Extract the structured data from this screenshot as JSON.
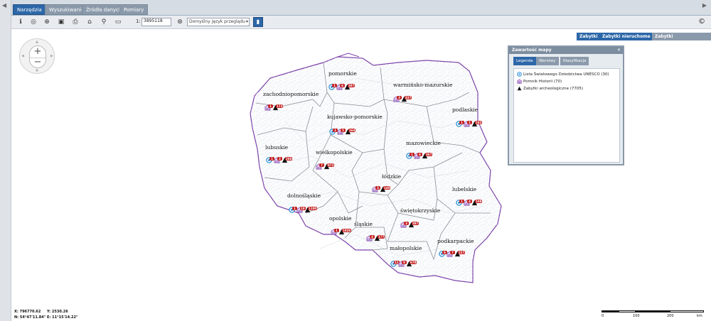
{
  "tabs": [
    {
      "label": "Narzędzia",
      "active": true
    },
    {
      "label": "Wyszukiwanie",
      "active": false
    },
    {
      "label": "Źródła danych",
      "active": false
    },
    {
      "label": "Pomiary",
      "active": false
    }
  ],
  "toolbar": {
    "scale_prefix": "1:",
    "scale_value": "3895118",
    "language_select": "Domyślny język przeglądu",
    "icons": [
      "info-icon",
      "identify-icon",
      "zoom-extent-icon",
      "save-icon",
      "print-icon",
      "home-icon",
      "link-icon",
      "screenshot-icon",
      "search-zoom-icon"
    ]
  },
  "layer_buttons": [
    {
      "label": "Zabytki",
      "color": "#2d67a8"
    },
    {
      "label": "Zabytki nieruchome",
      "color": "#2d67a8"
    },
    {
      "label": "Zabytki archeologiczne",
      "color": "#8b9aab"
    }
  ],
  "panel": {
    "title": "Zawartość mapy",
    "tabs": [
      {
        "label": "Legenda",
        "active": true
      },
      {
        "label": "Warstwy",
        "active": false
      },
      {
        "label": "Klasyfikacja",
        "active": false
      }
    ],
    "legend": [
      {
        "label": "Lista Światowego Dziedzictwa UNESCO (30)",
        "icon": "unesco-icon"
      },
      {
        "label": "Pomnik Historii (70)",
        "icon": "monument-icon"
      },
      {
        "label": "Zabytki archeologiczne (7705)",
        "icon": "archaeology-icon"
      }
    ]
  },
  "coordinates": {
    "x": "X: 796770.62",
    "y": "Y: 2530.26",
    "n": "N: 54°47'11.84\"",
    "e": "E: 11°15'14.22\""
  },
  "scalebar": {
    "labels": [
      "0",
      "100",
      "200"
    ],
    "unit": "km"
  },
  "regions": [
    {
      "name": "pomorskie",
      "unesco": "1",
      "monument": "6",
      "arch": "387"
    },
    {
      "name": "warmińsko-mazurskie",
      "unesco": "",
      "monument": "3",
      "arch": "437"
    },
    {
      "name": "zachodniopomorskie",
      "unesco": "",
      "monument": "1",
      "arch": "173"
    },
    {
      "name": "kujawsko-pomorskie",
      "unesco": "1",
      "monument": "5",
      "arch": "164"
    },
    {
      "name": "podlaskie",
      "unesco": "1",
      "monument": "1",
      "arch": "242"
    },
    {
      "name": "lubuskie",
      "unesco": "1",
      "monument": "2",
      "arch": "246"
    },
    {
      "name": "wielkopolskie",
      "unesco": "",
      "monument": "7",
      "arch": "872"
    },
    {
      "name": "mazowieckie",
      "unesco": "1",
      "monument": "6",
      "arch": "367"
    },
    {
      "name": "łódzkie",
      "unesco": "",
      "monument": "3",
      "arch": "140"
    },
    {
      "name": "lubelskie",
      "unesco": "1",
      "monument": "4",
      "arch": "108"
    },
    {
      "name": "dolnośląskie",
      "unesco": "1",
      "monument": "10",
      "arch": "1100"
    },
    {
      "name": "opolskie",
      "unesco": "",
      "monument": "1",
      "arch": "1026"
    },
    {
      "name": "świętokrzyskie",
      "unesco": "",
      "monument": "3",
      "arch": "387"
    },
    {
      "name": "śląskie",
      "unesco": "",
      "monument": "4",
      "arch": "177"
    },
    {
      "name": "podkarpackie",
      "unesco": "6",
      "monument": "7",
      "arch": "227"
    },
    {
      "name": "małopolskie",
      "unesco": "11",
      "monument": "8",
      "arch": "678"
    }
  ]
}
